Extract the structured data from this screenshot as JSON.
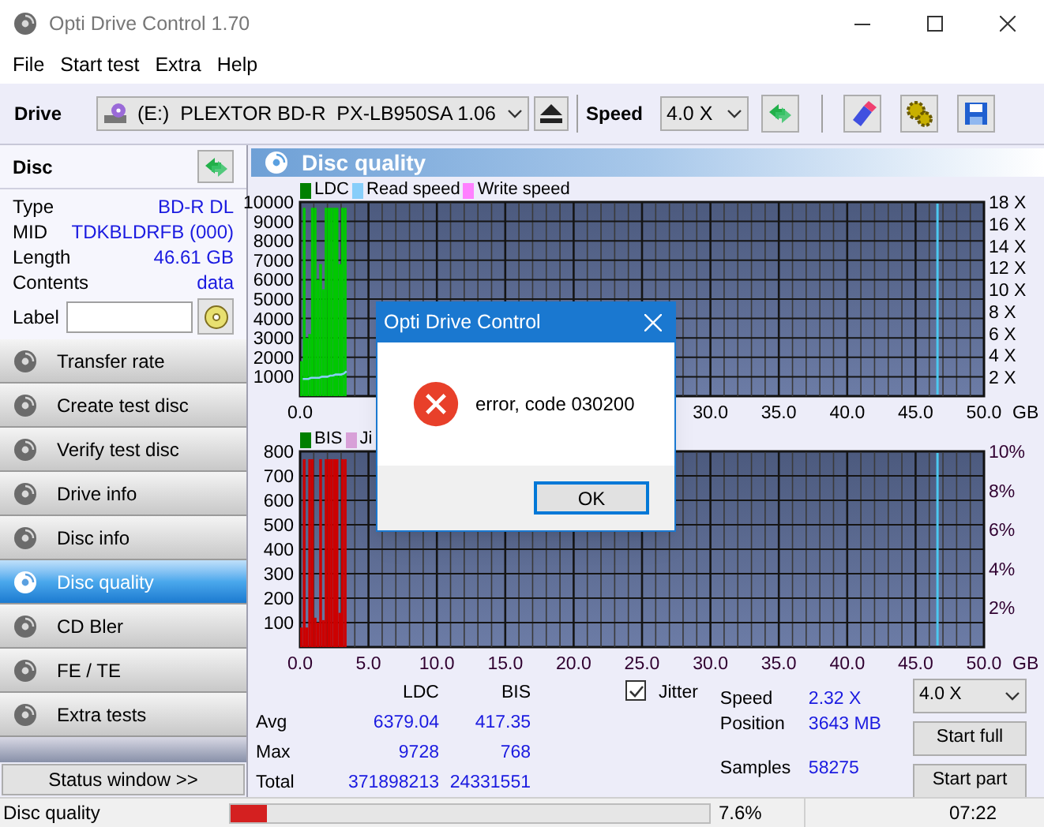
{
  "window": {
    "title": "Opti Drive Control 1.70"
  },
  "menu": [
    "File",
    "Start test",
    "Extra",
    "Help"
  ],
  "toolbar": {
    "drive_label": "Drive",
    "drive": "(E:)  PLEXTOR BD-R  PX-LB950SA 1.06",
    "speed_label": "Speed",
    "speed": "4.0 X"
  },
  "disc": {
    "title": "Disc",
    "fields": [
      {
        "label": "Type",
        "value": "BD-R DL"
      },
      {
        "label": "MID",
        "value": "TDKBLDRFB (000)"
      },
      {
        "label": "Length",
        "value": "46.61 GB"
      },
      {
        "label": "Contents",
        "value": "data"
      }
    ],
    "label_field": "Label"
  },
  "nav": [
    {
      "label": "Transfer rate",
      "selected": false
    },
    {
      "label": "Create test disc",
      "selected": false
    },
    {
      "label": "Verify test disc",
      "selected": false
    },
    {
      "label": "Drive info",
      "selected": false
    },
    {
      "label": "Disc info",
      "selected": false
    },
    {
      "label": "Disc quality",
      "selected": true
    },
    {
      "label": "CD Bler",
      "selected": false
    },
    {
      "label": "FE / TE",
      "selected": false
    },
    {
      "label": "Extra tests",
      "selected": false
    }
  ],
  "status_window_button": "Status window >>",
  "panel": {
    "title": "Disc quality",
    "charts": [
      {
        "legend": [
          {
            "label": "LDC",
            "color": "#008000"
          },
          {
            "label": "Read speed",
            "color": "#87cefa"
          },
          {
            "label": "Write speed",
            "color": "#ff80ff"
          }
        ],
        "right_ticks": [
          "18 X",
          "16 X",
          "14 X",
          "12 X",
          "10 X",
          "8 X",
          "6 X",
          "4 X",
          "2 X"
        ],
        "chart_data": {
          "type": "bar",
          "xlabel": "GB",
          "xlim": [
            0,
            50
          ],
          "ylim": [
            0,
            10000
          ],
          "grid": true,
          "xticks": [
            {
              "value": 0,
              "label": "0.0"
            },
            {
              "value": 30,
              "label": "30.0"
            },
            {
              "value": 35,
              "label": "35.0"
            },
            {
              "value": 40,
              "label": "40.0"
            },
            {
              "value": 45,
              "label": "45.0"
            },
            {
              "value": 50,
              "label": "50.0"
            }
          ],
          "yticks": [
            1000,
            2000,
            3000,
            4000,
            5000,
            6000,
            7000,
            8000,
            9000,
            10000
          ],
          "ref_lines": [
            {
              "axis": "x",
              "value": 46.6,
              "color": "#4cc8f0"
            }
          ],
          "x": [
            0.2,
            0.4,
            0.6,
            0.8,
            1.0,
            1.2,
            1.4,
            1.6,
            1.8,
            2.0,
            2.2,
            2.4,
            2.6,
            2.8,
            3.0,
            3.2,
            3.4
          ],
          "series": [
            {
              "color": "#00c800",
              "values": [
                1800,
                9700,
                3000,
                3200,
                9700,
                9700,
                6000,
                6800,
                5500,
                9700,
                9700,
                9700,
                9700,
                9700,
                6800,
                9700,
                9700
              ]
            },
            {
              "color": "#87cefa",
              "values": [
                1.6,
                1.6,
                1.6,
                1.7,
                1.7,
                1.7,
                1.7,
                1.8,
                1.8,
                1.8,
                1.9,
                1.9,
                2.0,
                2.0,
                2.0,
                2.1,
                2.3
              ]
            }
          ]
        }
      },
      {
        "legend": [
          {
            "label": "BIS",
            "color": "#008000"
          },
          {
            "label": "Ji",
            "color": "#d8a0d8"
          }
        ],
        "right_ticks": [
          "10%",
          "8%",
          "6%",
          "4%",
          "2%"
        ],
        "chart_data": {
          "type": "bar",
          "xlabel": "GB",
          "xlim": [
            0,
            50
          ],
          "ylim": [
            0,
            800
          ],
          "grid": true,
          "xticks": [
            {
              "value": 0,
              "label": "0.0"
            },
            {
              "value": 5,
              "label": "5.0"
            },
            {
              "value": 10,
              "label": "10.0"
            },
            {
              "value": 15,
              "label": "15.0"
            },
            {
              "value": 20,
              "label": "20.0"
            },
            {
              "value": 25,
              "label": "25.0"
            },
            {
              "value": 30,
              "label": "30.0"
            },
            {
              "value": 35,
              "label": "35.0"
            },
            {
              "value": 40,
              "label": "40.0"
            },
            {
              "value": 45,
              "label": "45.0"
            },
            {
              "value": 50,
              "label": "50.0"
            }
          ],
          "yticks": [
            100,
            200,
            300,
            400,
            500,
            600,
            700,
            800
          ],
          "ref_lines": [
            {
              "axis": "x",
              "value": 46.6,
              "color": "#4cc8f0"
            }
          ],
          "x": [
            0.2,
            0.4,
            0.6,
            0.8,
            1.0,
            1.2,
            1.4,
            1.6,
            1.8,
            2.0,
            2.2,
            2.4,
            2.6,
            2.8,
            3.0,
            3.2,
            3.4
          ],
          "series": [
            {
              "color": "#cc0000",
              "values": [
                80,
                768,
                80,
                768,
                768,
                120,
                100,
                768,
                110,
                768,
                768,
                768,
                768,
                768,
                140,
                768,
                768
              ]
            }
          ]
        }
      }
    ]
  },
  "stats": {
    "columns": [
      "LDC",
      "BIS"
    ],
    "rows": [
      {
        "label": "Avg",
        "values": [
          "6379.04",
          "417.35"
        ]
      },
      {
        "label": "Max",
        "values": [
          "9728",
          "768"
        ]
      },
      {
        "label": "Total",
        "values": [
          "371898213",
          "24331551"
        ]
      }
    ],
    "jitter": {
      "label": "Jitter",
      "checked": true
    },
    "info": [
      {
        "label": "Speed",
        "value": "2.32 X"
      },
      {
        "label": "Position",
        "value": "3643 MB"
      },
      {
        "label": "Samples",
        "value": "58275"
      }
    ],
    "speed": "4.0 X",
    "buttons": [
      "Start full",
      "Start part"
    ]
  },
  "dialog": {
    "title": "Opti Drive Control",
    "message": "error, code 030200",
    "button": "OK"
  },
  "status_bar": {
    "text": "Disc quality",
    "progress": {
      "level": 0.076
    },
    "percent": "7.6%",
    "time": "07:22"
  }
}
